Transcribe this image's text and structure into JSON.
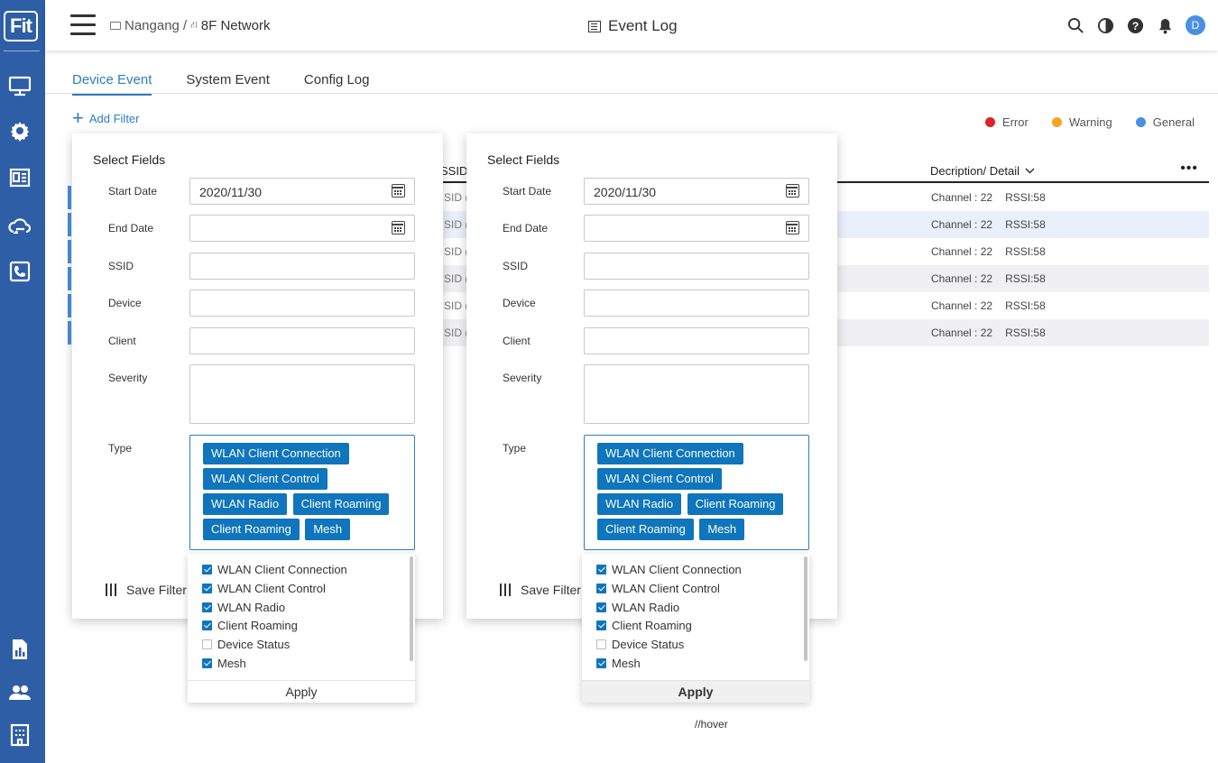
{
  "app": {
    "logo": "Fit"
  },
  "header": {
    "crumb_site": "Nangang",
    "crumb_sep": "/",
    "crumb_network": "8F Network",
    "title": "Event Log",
    "avatar": "D"
  },
  "tabs": [
    {
      "label": "Device Event",
      "active": true
    },
    {
      "label": "System Event",
      "active": false
    },
    {
      "label": "Config Log",
      "active": false
    }
  ],
  "add_filter": "Add Filter",
  "legend": [
    {
      "label": "Error",
      "color": "#e0202a"
    },
    {
      "label": "Warning",
      "color": "#f5a623"
    },
    {
      "label": "General",
      "color": "#4a90e2"
    }
  ],
  "table": {
    "col_ssid": "SSID",
    "col_desc": "Decription/ Detail",
    "more": "•••",
    "ssid_fragment": "SID (",
    "rows": [
      {
        "channel": "Channel : 22",
        "rssi": "RSSI:58"
      },
      {
        "channel": "Channel : 22",
        "rssi": "RSSI:58"
      },
      {
        "channel": "Channel : 22",
        "rssi": "RSSI:58"
      },
      {
        "channel": "Channel : 22",
        "rssi": "RSSI:58"
      },
      {
        "channel": "Channel : 22",
        "rssi": "RSSI:58"
      },
      {
        "channel": "Channel : 22",
        "rssi": "RSSI:58"
      }
    ]
  },
  "filter_panel": {
    "title": "Select Fields",
    "start_date_label": "Start Date",
    "start_date_value": "2020/11/30",
    "end_date_label": "End Date",
    "end_date_value": "",
    "ssid_label": "SSID",
    "device_label": "Device",
    "client_label": "Client",
    "severity_label": "Severity",
    "type_label": "Type",
    "chips": [
      "WLAN Client Connection",
      "WLAN Client Control",
      "WLAN Radio",
      "Client Roaming",
      "Client Roaming",
      "Mesh"
    ],
    "save_filter": "Save Filter",
    "options": [
      {
        "label": "WLAN Client Connection",
        "checked": true
      },
      {
        "label": "WLAN Client Control",
        "checked": true
      },
      {
        "label": "WLAN Radio",
        "checked": true
      },
      {
        "label": "Client Roaming",
        "checked": true
      },
      {
        "label": "Device Status",
        "checked": false
      },
      {
        "label": "Mesh",
        "checked": true
      }
    ],
    "apply": "Apply"
  },
  "hover_note": "//hover"
}
